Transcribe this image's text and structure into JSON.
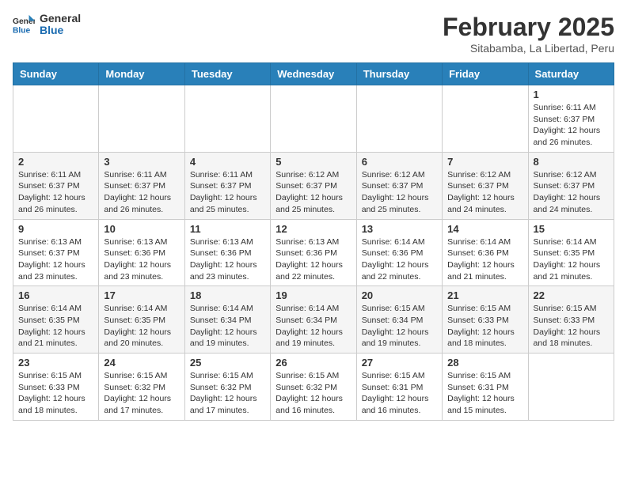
{
  "header": {
    "logo_line1": "General",
    "logo_line2": "Blue",
    "month_year": "February 2025",
    "location": "Sitabamba, La Libertad, Peru"
  },
  "days_of_week": [
    "Sunday",
    "Monday",
    "Tuesday",
    "Wednesday",
    "Thursday",
    "Friday",
    "Saturday"
  ],
  "weeks": [
    [
      {
        "day": "",
        "info": ""
      },
      {
        "day": "",
        "info": ""
      },
      {
        "day": "",
        "info": ""
      },
      {
        "day": "",
        "info": ""
      },
      {
        "day": "",
        "info": ""
      },
      {
        "day": "",
        "info": ""
      },
      {
        "day": "1",
        "info": "Sunrise: 6:11 AM\nSunset: 6:37 PM\nDaylight: 12 hours and 26 minutes."
      }
    ],
    [
      {
        "day": "2",
        "info": "Sunrise: 6:11 AM\nSunset: 6:37 PM\nDaylight: 12 hours and 26 minutes."
      },
      {
        "day": "3",
        "info": "Sunrise: 6:11 AM\nSunset: 6:37 PM\nDaylight: 12 hours and 26 minutes."
      },
      {
        "day": "4",
        "info": "Sunrise: 6:11 AM\nSunset: 6:37 PM\nDaylight: 12 hours and 25 minutes."
      },
      {
        "day": "5",
        "info": "Sunrise: 6:12 AM\nSunset: 6:37 PM\nDaylight: 12 hours and 25 minutes."
      },
      {
        "day": "6",
        "info": "Sunrise: 6:12 AM\nSunset: 6:37 PM\nDaylight: 12 hours and 25 minutes."
      },
      {
        "day": "7",
        "info": "Sunrise: 6:12 AM\nSunset: 6:37 PM\nDaylight: 12 hours and 24 minutes."
      },
      {
        "day": "8",
        "info": "Sunrise: 6:12 AM\nSunset: 6:37 PM\nDaylight: 12 hours and 24 minutes."
      }
    ],
    [
      {
        "day": "9",
        "info": "Sunrise: 6:13 AM\nSunset: 6:37 PM\nDaylight: 12 hours and 23 minutes."
      },
      {
        "day": "10",
        "info": "Sunrise: 6:13 AM\nSunset: 6:36 PM\nDaylight: 12 hours and 23 minutes."
      },
      {
        "day": "11",
        "info": "Sunrise: 6:13 AM\nSunset: 6:36 PM\nDaylight: 12 hours and 23 minutes."
      },
      {
        "day": "12",
        "info": "Sunrise: 6:13 AM\nSunset: 6:36 PM\nDaylight: 12 hours and 22 minutes."
      },
      {
        "day": "13",
        "info": "Sunrise: 6:14 AM\nSunset: 6:36 PM\nDaylight: 12 hours and 22 minutes."
      },
      {
        "day": "14",
        "info": "Sunrise: 6:14 AM\nSunset: 6:36 PM\nDaylight: 12 hours and 21 minutes."
      },
      {
        "day": "15",
        "info": "Sunrise: 6:14 AM\nSunset: 6:35 PM\nDaylight: 12 hours and 21 minutes."
      }
    ],
    [
      {
        "day": "16",
        "info": "Sunrise: 6:14 AM\nSunset: 6:35 PM\nDaylight: 12 hours and 21 minutes."
      },
      {
        "day": "17",
        "info": "Sunrise: 6:14 AM\nSunset: 6:35 PM\nDaylight: 12 hours and 20 minutes."
      },
      {
        "day": "18",
        "info": "Sunrise: 6:14 AM\nSunset: 6:34 PM\nDaylight: 12 hours and 19 minutes."
      },
      {
        "day": "19",
        "info": "Sunrise: 6:14 AM\nSunset: 6:34 PM\nDaylight: 12 hours and 19 minutes."
      },
      {
        "day": "20",
        "info": "Sunrise: 6:15 AM\nSunset: 6:34 PM\nDaylight: 12 hours and 19 minutes."
      },
      {
        "day": "21",
        "info": "Sunrise: 6:15 AM\nSunset: 6:33 PM\nDaylight: 12 hours and 18 minutes."
      },
      {
        "day": "22",
        "info": "Sunrise: 6:15 AM\nSunset: 6:33 PM\nDaylight: 12 hours and 18 minutes."
      }
    ],
    [
      {
        "day": "23",
        "info": "Sunrise: 6:15 AM\nSunset: 6:33 PM\nDaylight: 12 hours and 18 minutes."
      },
      {
        "day": "24",
        "info": "Sunrise: 6:15 AM\nSunset: 6:32 PM\nDaylight: 12 hours and 17 minutes."
      },
      {
        "day": "25",
        "info": "Sunrise: 6:15 AM\nSunset: 6:32 PM\nDaylight: 12 hours and 17 minutes."
      },
      {
        "day": "26",
        "info": "Sunrise: 6:15 AM\nSunset: 6:32 PM\nDaylight: 12 hours and 16 minutes."
      },
      {
        "day": "27",
        "info": "Sunrise: 6:15 AM\nSunset: 6:31 PM\nDaylight: 12 hours and 16 minutes."
      },
      {
        "day": "28",
        "info": "Sunrise: 6:15 AM\nSunset: 6:31 PM\nDaylight: 12 hours and 15 minutes."
      },
      {
        "day": "",
        "info": ""
      }
    ]
  ]
}
